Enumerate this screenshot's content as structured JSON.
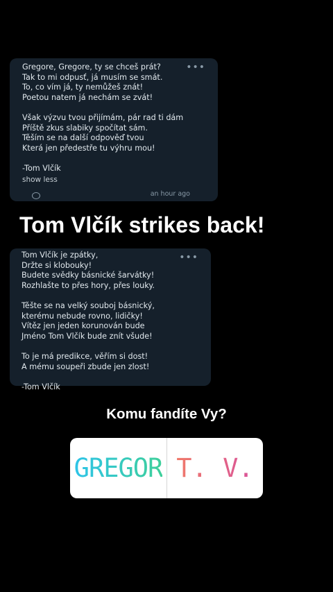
{
  "post1": {
    "menu": "•••",
    "lines": [
      "Gregore, Gregore, ty se chceš prát?",
      "Tak to mi odpusť, já musím se smát.",
      "To, co vím já, ty nemůžeš znát!",
      "Poetou natem já nechám se zvát!",
      "",
      "Však výzvu tvou přijímám, pár rad ti dám",
      "Příště zkus slabiky spočítat sám.",
      "Těším se na další odpověď tvou",
      "Která jen předestře tu výhru mou!",
      "",
      "-Tom Vlčík"
    ],
    "show_less": "show less",
    "time": "an hour ago"
  },
  "caption": "Tom Vlčík strikes back!",
  "post2": {
    "menu": "•••",
    "lines": [
      "Tom Vlčík je zpátky,",
      "Držte si klobouky!",
      "Budete svědky básnické šarvátky!",
      "Rozhlašte to přes hory, přes louky.",
      "",
      "Těšte se na velký souboj básnický,",
      "kterému nebude rovno, lidičky!",
      "Vítěz jen jeden korunován bude",
      "Jméno Tom Vlčík bude znít všude!",
      "",
      "To je má predikce, věřím si dost!",
      "A mému soupeři zbude jen zlost!",
      "",
      "-Tom Vlčík"
    ]
  },
  "poll": {
    "question": "Komu fandíte Vy?",
    "option1": "GREGOR",
    "option2": "T. V."
  }
}
